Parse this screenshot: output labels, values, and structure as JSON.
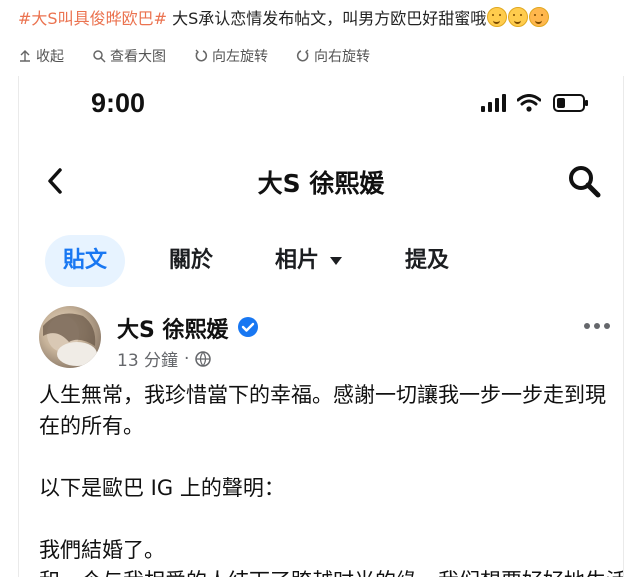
{
  "caption": {
    "topic": "#大S叫具俊晔欧巴#",
    "text": " 大S承认恋情发布帖文，叫男方欧巴好甜蜜哦",
    "emojis": [
      "smile-emoji",
      "smile-emoji",
      "scream-emoji"
    ]
  },
  "toolbar": {
    "collapse": "收起",
    "view_large": "查看大图",
    "rotate_left": "向左旋转",
    "rotate_right": "向右旋转"
  },
  "phone": {
    "status": {
      "time": "9:00",
      "icons": [
        "signal-icon",
        "wifi-icon",
        "battery-icon"
      ],
      "battery_level": 0.35
    },
    "nav": {
      "title": "大S 徐熙媛",
      "icons": [
        "back-icon",
        "search-icon"
      ]
    },
    "tabs": [
      {
        "label": "貼文",
        "active": true
      },
      {
        "label": "關於",
        "active": false
      },
      {
        "label": "相片",
        "active": false,
        "dropdown": true
      },
      {
        "label": "提及",
        "active": false
      }
    ],
    "post": {
      "author": "大S 徐熙媛",
      "verified": true,
      "time": "13 分鐘",
      "separator": "·",
      "privacy_icon": "globe-icon",
      "paragraphs": [
        "人生無常，我珍惜當下的幸福。感謝一切讓我一步一步走到現在的所有。",
        "以下是歐巴 IG 上的聲明：",
        "我們結婚了。",
        "和一个与我相爱的人结下了跨越时光的缘。我们想要好好地生活"
      ]
    }
  },
  "colors": {
    "accent": "#1877f2",
    "tab_active_bg": "#e7f3ff",
    "topic": "#eb7350",
    "muted": "#65676b"
  }
}
